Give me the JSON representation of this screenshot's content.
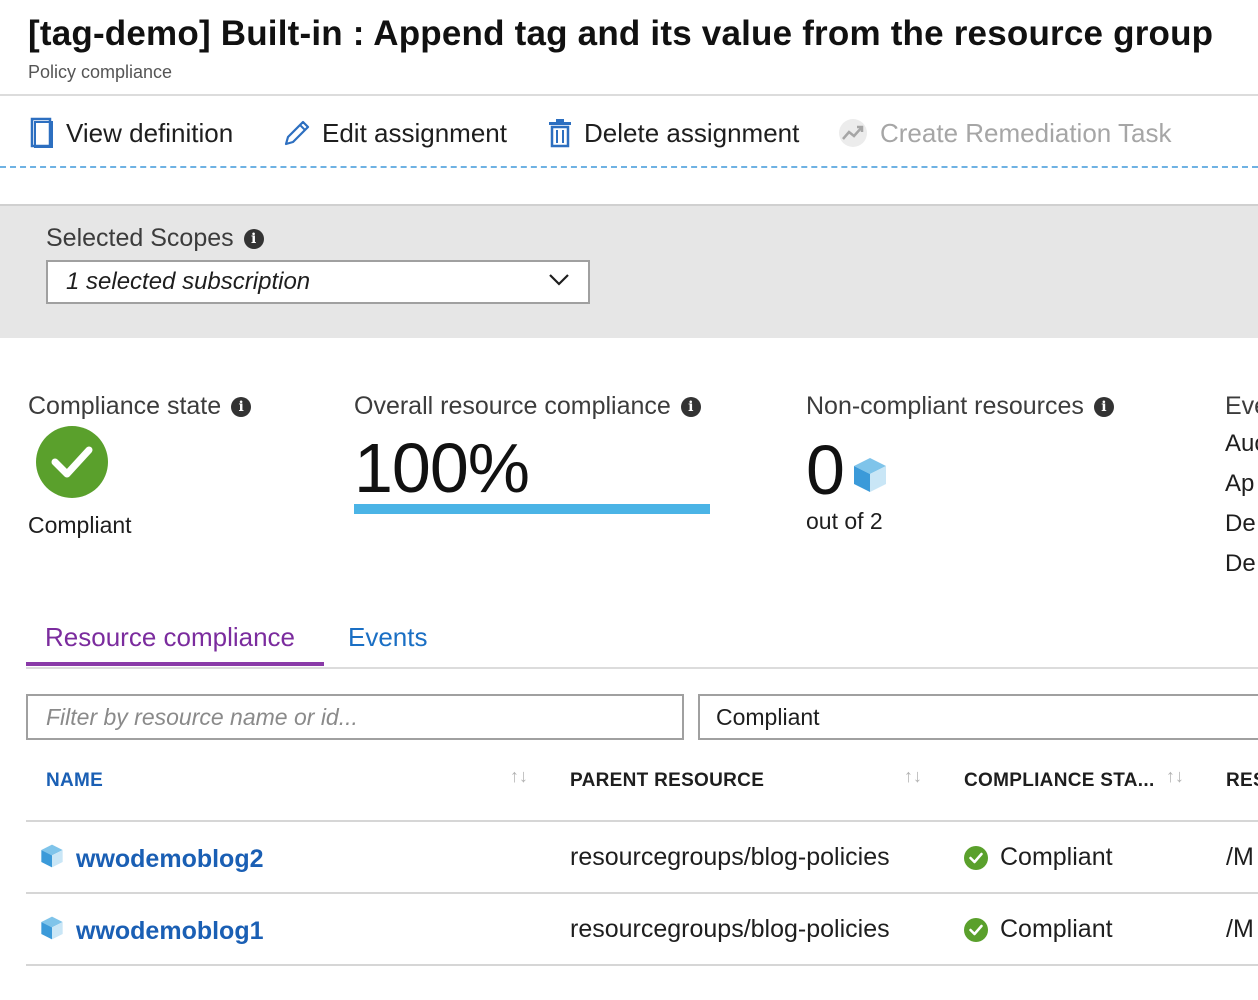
{
  "header": {
    "title": "[tag-demo] Built-in : Append tag and its value from the resource group",
    "subtitle": "Policy compliance"
  },
  "toolbar": {
    "view_definition": "View definition",
    "edit_assignment": "Edit assignment",
    "delete_assignment": "Delete assignment",
    "create_remediation": "Create Remediation Task"
  },
  "scope": {
    "label": "Selected Scopes",
    "value": "1 selected subscription"
  },
  "metrics": {
    "compliance_state_label": "Compliance state",
    "compliance_state_value": "Compliant",
    "overall_label": "Overall resource compliance",
    "overall_value": "100%",
    "overall_fraction": 1.0,
    "noncompliant_label": "Non-compliant resources",
    "noncompliant_count": "0",
    "noncompliant_outof": "out of 2",
    "events_label": "Eve",
    "events_items": [
      "Auc",
      "Ap",
      "De",
      "De"
    ]
  },
  "tabs": {
    "resource_compliance": "Resource compliance",
    "events": "Events"
  },
  "filters": {
    "search_placeholder": "Filter by resource name or id...",
    "state_value": "Compliant"
  },
  "table": {
    "columns": [
      "NAME",
      "PARENT RESOURCE",
      "COMPLIANCE STA...",
      "RES"
    ],
    "rows": [
      {
        "name": "wwodemoblog2",
        "parent": "resourcegroups/blog-policies",
        "status": "Compliant",
        "resource": "/M"
      },
      {
        "name": "wwodemoblog1",
        "parent": "resourcegroups/blog-policies",
        "status": "Compliant",
        "resource": "/M"
      }
    ]
  },
  "colors": {
    "accent_blue": "#1a5fb4",
    "tab_purple": "#7b2c9e",
    "compliant_green": "#5aa02c",
    "progress_blue": "#4bb4e6"
  }
}
